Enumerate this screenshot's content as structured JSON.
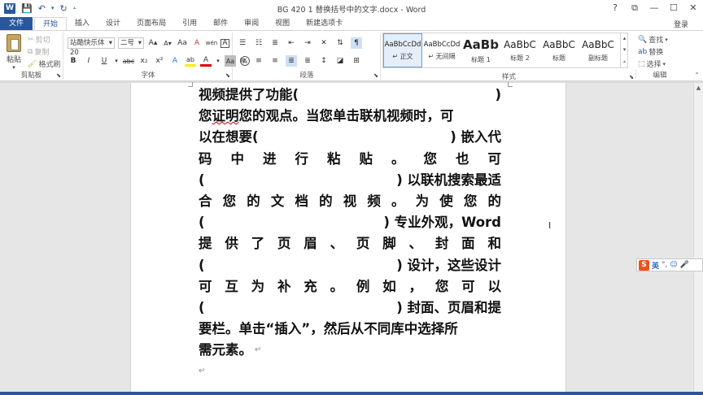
{
  "window": {
    "title": "BG 420 1 替换括号中的文字.docx - Word",
    "login": "登录",
    "app_logo": "W",
    "controls": [
      "?",
      "⧉",
      "—",
      "☐",
      "✕"
    ]
  },
  "tabs": [
    {
      "label": "文件"
    },
    {
      "label": "开始"
    },
    {
      "label": "插入"
    },
    {
      "label": "设计"
    },
    {
      "label": "页面布局"
    },
    {
      "label": "引用"
    },
    {
      "label": "邮件"
    },
    {
      "label": "审阅"
    },
    {
      "label": "视图"
    },
    {
      "label": "新建选项卡"
    }
  ],
  "ribbon": {
    "clipboard": {
      "group_label": "剪贴板",
      "paste": "粘贴",
      "cut": "剪切",
      "copy": "复制",
      "format_painter": "格式刷"
    },
    "font": {
      "group_label": "字体",
      "font_name": "站酷快乐体20",
      "font_size": "二号",
      "buttons_row1": [
        "A",
        "A",
        "Aa",
        "A",
        "wén",
        "A"
      ],
      "buttons_row2": [
        "B",
        "I",
        "U",
        "abc",
        "x₂",
        "x²",
        "A",
        "ab",
        "A",
        "Aa",
        "A"
      ]
    },
    "paragraph": {
      "group_label": "段落"
    },
    "styles": {
      "group_label": "样式",
      "items": [
        {
          "preview": "AaBbCcDd",
          "name": "↵ 正文"
        },
        {
          "preview": "AaBbCcDd",
          "name": "↵ 无间隔"
        },
        {
          "preview": "AaBb",
          "name": "标题 1"
        },
        {
          "preview": "AaBbC",
          "name": "标题 2"
        },
        {
          "preview": "AaBbC",
          "name": "标题"
        },
        {
          "preview": "AaBbC",
          "name": "副标题"
        }
      ]
    },
    "editing": {
      "group_label": "编辑",
      "find": "查找",
      "replace": "替换",
      "select": "选择"
    }
  },
  "document": {
    "lines": [
      {
        "parts": [
          "视频提供了功能(",
          "BLANK",
          ")"
        ],
        "mode": "split"
      },
      {
        "parts": [
          "您证明您的观点。当您单击联机视频时，可"
        ],
        "mode": "plain"
      },
      {
        "parts": [
          "以在想要(",
          "BLANK",
          ") 嵌入代"
        ],
        "mode": "split"
      },
      {
        "parts": [
          "码",
          "中",
          "进",
          "行",
          "粘",
          "贴",
          "。",
          "您",
          "也",
          "可"
        ],
        "mode": "just"
      },
      {
        "parts": [
          "(",
          "BLANK",
          ") 以联机搜索最适"
        ],
        "mode": "split"
      },
      {
        "parts": [
          "合",
          "您",
          "的",
          "文",
          "档",
          "的",
          "视",
          "频",
          "。",
          "为",
          "使",
          "您",
          "的"
        ],
        "mode": "just"
      },
      {
        "parts": [
          "(",
          "BLANK",
          ") 专业外观，Word"
        ],
        "mode": "split"
      },
      {
        "parts": [
          "提",
          "供",
          "了",
          "页",
          "眉",
          "、",
          "页",
          "脚",
          "、",
          "封",
          "面",
          "和"
        ],
        "mode": "just"
      },
      {
        "parts": [
          "(",
          "BLANK",
          ") 设计，这些设计"
        ],
        "mode": "split"
      },
      {
        "parts": [
          "可",
          "互",
          "为",
          "补",
          "充",
          "。",
          "例",
          "如",
          "，",
          "您",
          "可",
          "以"
        ],
        "mode": "just"
      },
      {
        "parts": [
          "(",
          "BLANK",
          ") 封面、页眉和提"
        ],
        "mode": "split"
      },
      {
        "parts": [
          "要栏。单击“插入”，然后从不同库中选择所"
        ],
        "mode": "plain"
      },
      {
        "parts": [
          "需元素。"
        ],
        "mode": "end"
      }
    ],
    "paragraph_mark": "↵"
  },
  "ime": {
    "logo": "S",
    "mode": "英"
  },
  "colors": {
    "accent": "#2b579a",
    "ime_logo": "#e8541d"
  }
}
